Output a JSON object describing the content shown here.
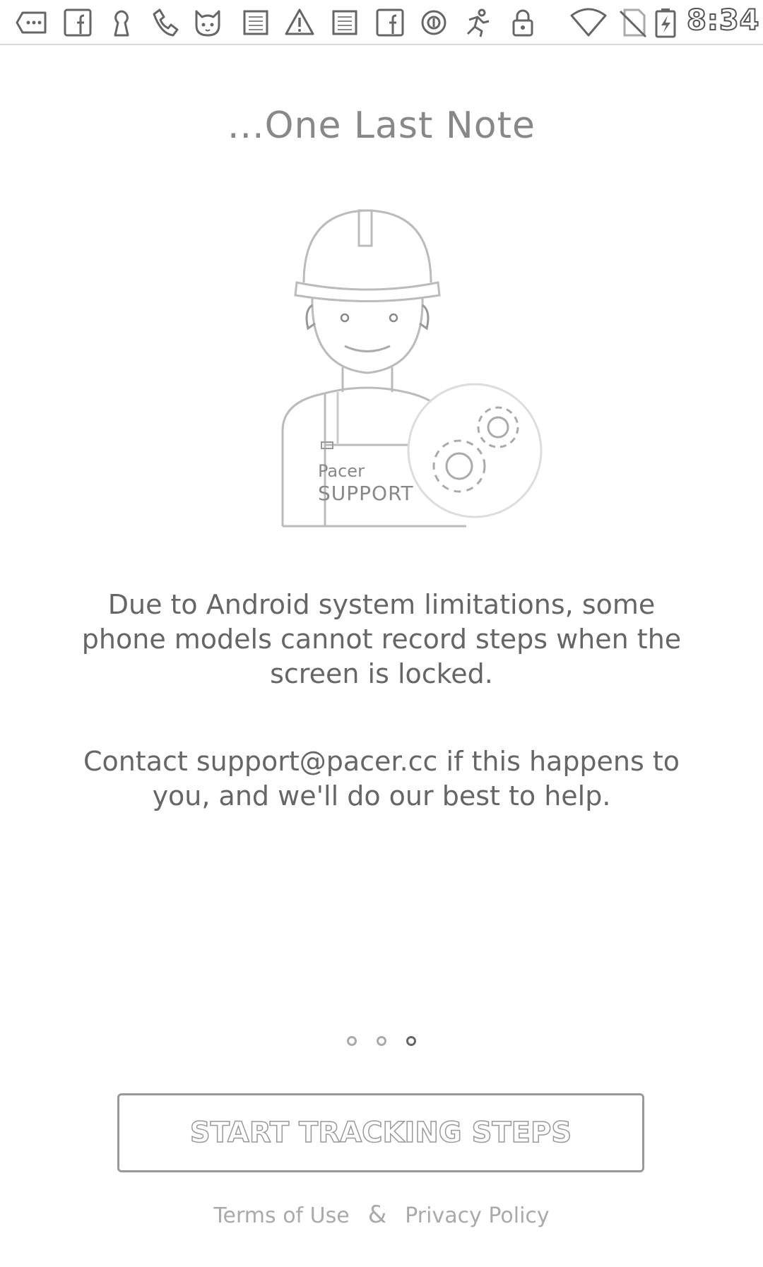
{
  "status_bar": {
    "time": "8:34",
    "left_icons": [
      "messages-icon",
      "facebook-icon",
      "keyhole-icon",
      "phone-icon",
      "cat-face-icon",
      "image-icon",
      "warning-icon",
      "image-icon",
      "facebook-icon",
      "record-icon",
      "runner-icon",
      "lock-icon"
    ],
    "right_icons": [
      "wifi-icon",
      "no-sim-icon",
      "battery-charging-icon"
    ]
  },
  "onboarding": {
    "title": "...One Last Note",
    "illustration": {
      "badge_line1": "Pacer",
      "badge_line2": "SUPPORT"
    },
    "message_1": "Due to Android system limitations, some phone models cannot record steps when the screen is locked.",
    "message_2": "Contact support@pacer.cc if this happens to you, and we'll do our best to help.",
    "page_indicator": {
      "count": 3,
      "current": 3
    },
    "start_button_label": "START TRACKING STEPS",
    "footer": {
      "terms_label": "Terms of Use",
      "separator": "&",
      "privacy_label": "Privacy Policy"
    }
  },
  "colors": {
    "text": "#666666",
    "title": "#888888",
    "button_border": "#999999",
    "footer": "#aaaaaa"
  }
}
